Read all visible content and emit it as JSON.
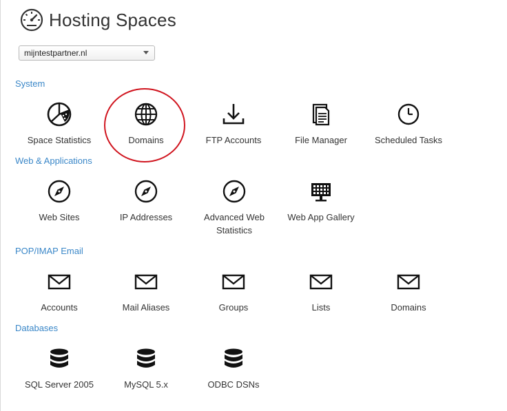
{
  "header": {
    "title": "Hosting Spaces",
    "icon": "dashboard-gauge-icon"
  },
  "space_selector": {
    "selected": "mijntestpartner.nl"
  },
  "sections": [
    {
      "title": "System",
      "items": [
        {
          "label": "Space Statistics",
          "icon": "pie-chart-icon"
        },
        {
          "label": "Domains",
          "icon": "globe-icon"
        },
        {
          "label": "FTP Accounts",
          "icon": "download-icon"
        },
        {
          "label": "File Manager",
          "icon": "document-icon"
        },
        {
          "label": "Scheduled Tasks",
          "icon": "clock-icon"
        }
      ]
    },
    {
      "title": "Web & Applications",
      "items": [
        {
          "label": "Web Sites",
          "icon": "compass-icon"
        },
        {
          "label": "IP Addresses",
          "icon": "compass-icon"
        },
        {
          "label": "Advanced Web Statistics",
          "icon": "compass-icon"
        },
        {
          "label": "Web App Gallery",
          "icon": "monitor-grid-icon"
        }
      ]
    },
    {
      "title": "POP/IMAP Email",
      "items": [
        {
          "label": "Accounts",
          "icon": "envelope-icon"
        },
        {
          "label": "Mail Aliases",
          "icon": "envelope-icon"
        },
        {
          "label": "Groups",
          "icon": "envelope-icon"
        },
        {
          "label": "Lists",
          "icon": "envelope-icon"
        },
        {
          "label": "Domains",
          "icon": "envelope-icon"
        }
      ]
    },
    {
      "title": "Databases",
      "items": [
        {
          "label": "SQL Server 2005",
          "icon": "database-icon"
        },
        {
          "label": "MySQL 5.x",
          "icon": "database-icon"
        },
        {
          "label": "ODBC DSNs",
          "icon": "database-icon"
        }
      ]
    }
  ],
  "colors": {
    "section_title": "#3a87c8",
    "highlight_ring": "#d0141e"
  }
}
